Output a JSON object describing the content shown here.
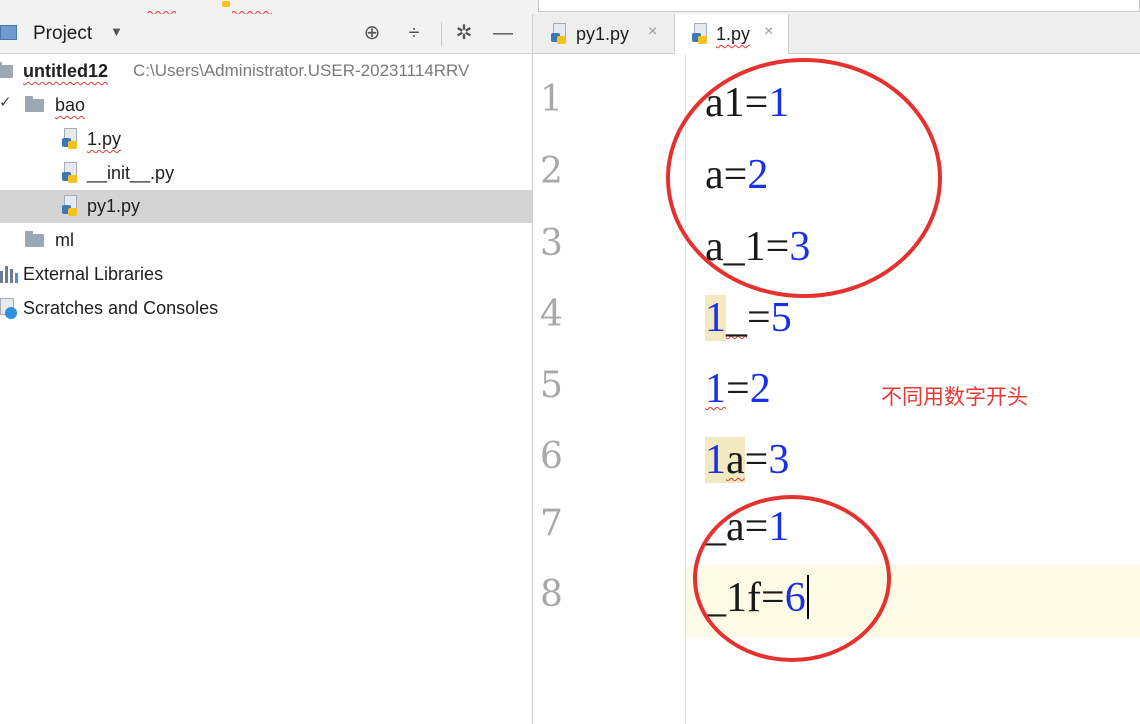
{
  "project_panel": {
    "title": "Project",
    "tree": {
      "root_name": "untitled12",
      "root_path": "C:\\Users\\Administrator.USER-20231114RRV",
      "folder_bao": "bao",
      "files": [
        "1.py",
        "__init__.py",
        "py1.py"
      ],
      "folder_ml": "ml",
      "external_libraries": "External Libraries",
      "scratches": "Scratches and Consoles"
    },
    "selected_item": "py1.py"
  },
  "editor": {
    "tabs": [
      {
        "label": "py1.py",
        "active": false
      },
      {
        "label": "1.py",
        "active": true
      }
    ],
    "lines": [
      {
        "number": "1",
        "code": "a1=1"
      },
      {
        "number": "2",
        "code": "a=2"
      },
      {
        "number": "3",
        "code": "a_1=3"
      },
      {
        "number": "4",
        "code": "1_=5"
      },
      {
        "number": "5",
        "code": "1=2"
      },
      {
        "number": "6",
        "code": "1a=3"
      },
      {
        "number": "7",
        "code": "_a=1"
      },
      {
        "number": "8",
        "code": "_1f=6"
      }
    ],
    "current_line": 8,
    "annotation": "不同用数字开头"
  },
  "colors": {
    "number_literal": "#1a30e6",
    "annotation": "#e53935",
    "current_line_bg": "#fdfae6",
    "selected_row_bg": "#d4d4d4"
  }
}
